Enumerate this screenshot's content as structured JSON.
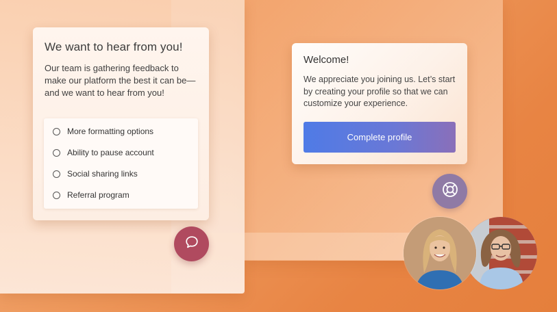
{
  "feedback_card": {
    "title": "We want to hear from you!",
    "description": "Our team is gathering feedback to make our platform the best it can be—and we want to hear from you!",
    "options": [
      "More formatting options",
      "Ability to pause account",
      "Social sharing links",
      "Referral program"
    ]
  },
  "welcome_card": {
    "title": "Welcome!",
    "description": "We appreciate you joining us. Let’s start by creating your profile so that we can customize your experience.",
    "button_label": "Complete profile"
  },
  "icons": {
    "chat": "chat-bubble-icon",
    "help": "lifebuoy-icon"
  },
  "colors": {
    "background": "#ee9a5e",
    "chat_button": "#b04a5f",
    "help_button": "#8f7aa5",
    "button_gradient_start": "#4f7be6",
    "button_gradient_end": "#8a6fb9"
  }
}
